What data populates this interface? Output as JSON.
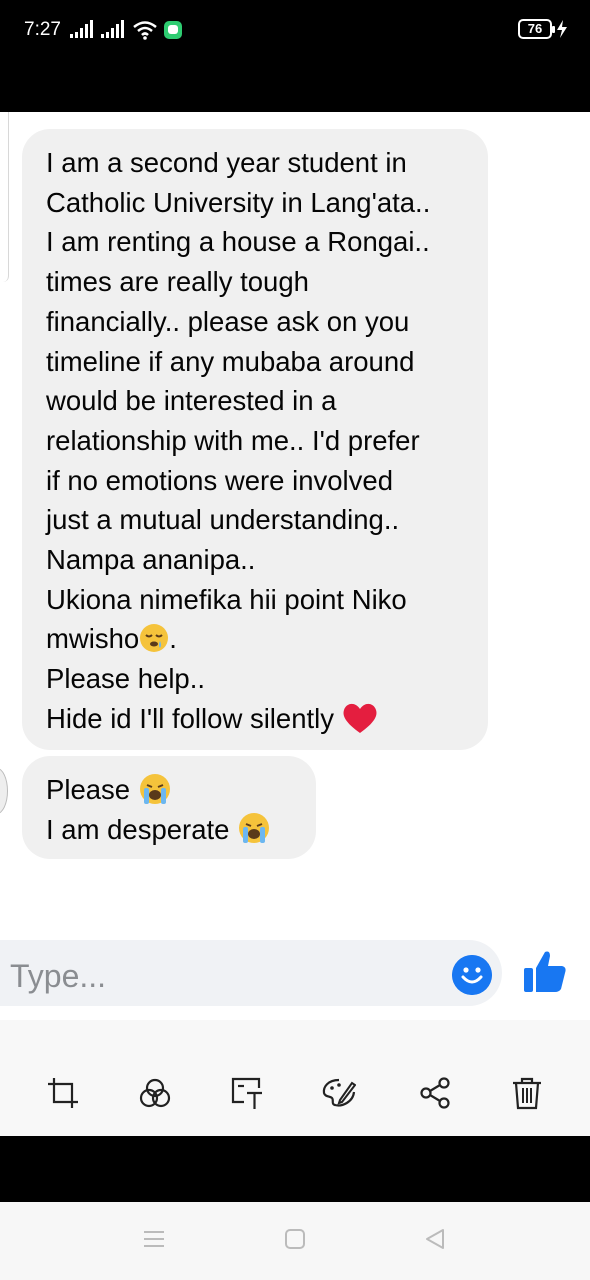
{
  "status_bar": {
    "time": "7:27",
    "battery": "76"
  },
  "messages": [
    {
      "lines": [
        "I am a second year student in",
        "Catholic University in Lang'ata..",
        "I am renting a house a Rongai..",
        "times are really tough",
        "financially.. please ask on you",
        "timeline if any mubaba around",
        "would be interested in a",
        "relationship with me.. I'd prefer",
        "if no emotions were involved",
        "just a mutual understanding..",
        "Nampa ananipa..",
        "Ukiona nimefika hii point Niko",
        "mwisho",
        ".",
        "Please help..",
        "Hide id I'll follow silently"
      ],
      "emojis": [
        "sleepy-face",
        "red-heart"
      ]
    },
    {
      "lines": [
        "Please",
        "I am desperate"
      ],
      "emojis": [
        "loudly-crying-face",
        "loudly-crying-face"
      ]
    }
  ],
  "composer": {
    "placeholder": "Type..."
  },
  "toolbar": {
    "tools": [
      "crop-icon",
      "filter-icon",
      "text-icon",
      "paint-icon",
      "share-icon",
      "delete-icon"
    ]
  },
  "colors": {
    "bubble": "#f0f0f0",
    "accent": "#1877f2",
    "heart": "#e41e3f"
  }
}
